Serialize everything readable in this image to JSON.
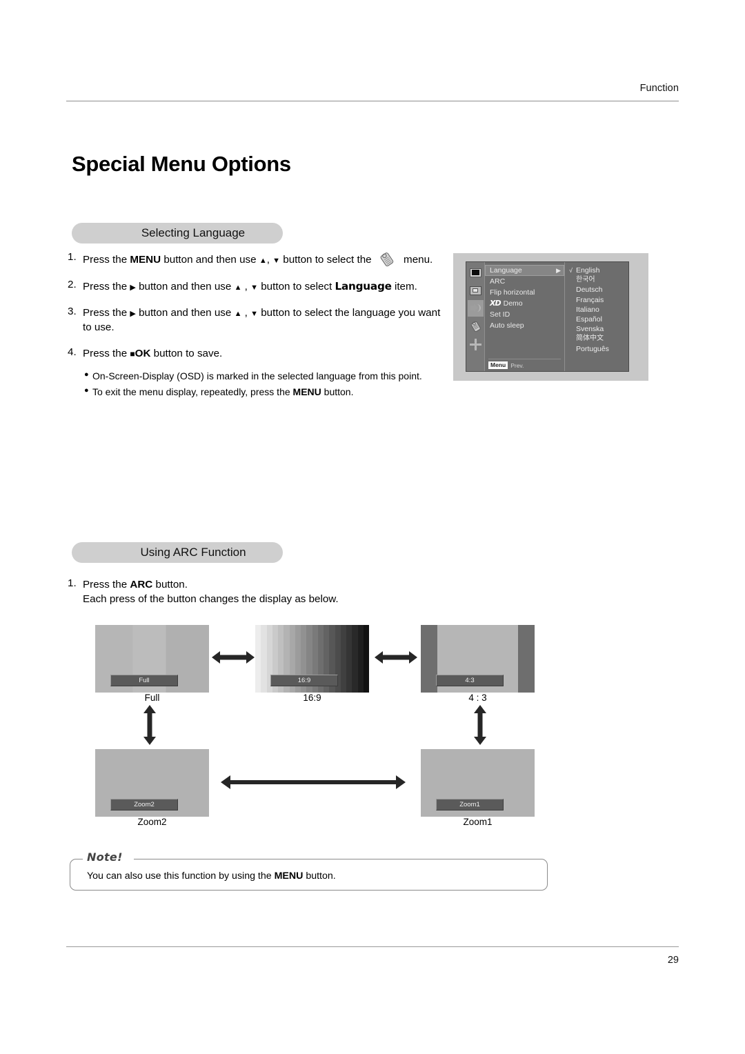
{
  "header": {
    "section_label": "Function"
  },
  "page_title": "Special Menu Options",
  "footer": {
    "page_number": "29"
  },
  "sections": {
    "language": {
      "pill_title": "Selecting Language",
      "steps": [
        {
          "num": "1.",
          "html_key": "step1"
        },
        {
          "num": "2.",
          "html_key": "step2"
        },
        {
          "num": "3.",
          "html_key": "step3"
        },
        {
          "num": "4.",
          "html_key": "step4"
        }
      ],
      "step1_a": "Press the ",
      "step1_menu": "MENU",
      "step1_b": " button and then use ",
      "step1_c": " button to select the ",
      "step1_d": " menu.",
      "step2_a": "Press the ",
      "step2_b": " button and then use ",
      "step2_c": " button to select ",
      "step2_lang": "Language",
      "step2_d": " item.",
      "step3_a": "Press the ",
      "step3_b": " button and then use ",
      "step3_c": " button to select the language you want to use.",
      "step4_a": "Press the ",
      "step4_ok": "OK",
      "step4_b": " button to save.",
      "bullets": [
        {
          "text": "On-Screen-Display (OSD) is marked in the selected language from this point."
        },
        {
          "pre": "To exit the menu display, repeatedly, press the ",
          "bold": "MENU",
          "post": " button."
        }
      ]
    },
    "arc": {
      "pill_title": "Using ARC Function",
      "step1_a": "Press the ",
      "step1_bold": "ARC",
      "step1_b": " button.",
      "step1_line2": "Each press of the button changes the display as below."
    }
  },
  "osd": {
    "sidebar_icons": [
      {
        "name": "picture-icon",
        "selected": false
      },
      {
        "name": "screen-icon",
        "selected": false
      },
      {
        "name": "sound-mute-icon",
        "selected": true
      },
      {
        "name": "special-tag-icon",
        "selected": false
      },
      {
        "name": "arrows-cross-icon",
        "selected": false
      }
    ],
    "menu_items": [
      {
        "label": "Language",
        "selected": true,
        "arrow": "▶"
      },
      {
        "label": "ARC",
        "selected": false
      },
      {
        "label": "Flip horizontal",
        "selected": false
      },
      {
        "label": "Demo",
        "selected": false,
        "logo": "XD"
      },
      {
        "label": "Set ID",
        "selected": false
      },
      {
        "label": "Auto sleep",
        "selected": false
      }
    ],
    "footer_chip": "Menu",
    "footer_text": "Prev.",
    "languages": [
      {
        "label": "English",
        "check": "√"
      },
      {
        "label": "한국어",
        "check": "",
        "cjk": true
      },
      {
        "label": "Deutsch",
        "check": ""
      },
      {
        "label": "Français",
        "check": ""
      },
      {
        "label": "Italiano",
        "check": ""
      },
      {
        "label": "Español",
        "check": ""
      },
      {
        "label": "Svenska",
        "check": ""
      },
      {
        "label": "简体中文",
        "check": "",
        "cjk": true
      },
      {
        "label": "Português",
        "check": ""
      }
    ]
  },
  "arc_modes": [
    {
      "id": "full",
      "badge": "Full",
      "caption": "Full"
    },
    {
      "id": "16_9",
      "badge": "16:9",
      "caption": "16:9"
    },
    {
      "id": "4_3",
      "badge": "4:3",
      "caption": "4 : 3"
    },
    {
      "id": "zoom2",
      "badge": "Zoom2",
      "caption": "Zoom2"
    },
    {
      "id": "zoom1",
      "badge": "Zoom1",
      "caption": "Zoom1"
    }
  ],
  "note": {
    "label": "Note!",
    "pre": "You can also use this function by using the ",
    "bold": "MENU",
    "post": " button."
  },
  "colors": {
    "pill_bg": "#cfcfcf",
    "osd_bg": "#6d6d6d",
    "osd_selected": "#868686",
    "thumb_gray": "#b6b6b6",
    "rule": "#8d8d8d"
  }
}
